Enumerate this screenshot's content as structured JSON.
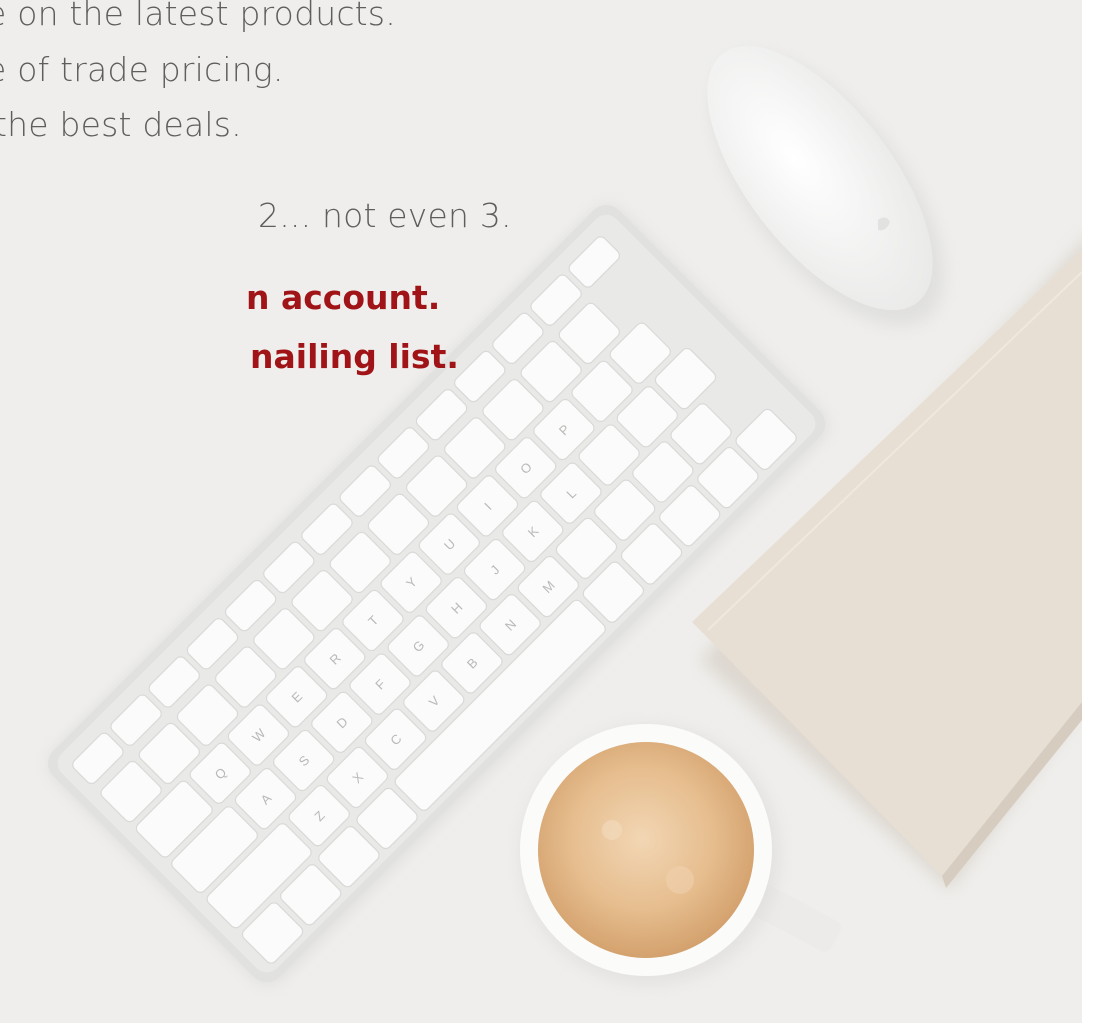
{
  "copy": {
    "line1": "e on the latest products.",
    "line2": "e of trade pricing.",
    "line3": "the best deals.",
    "line4": "2... not even 3.",
    "cta1": "n account.",
    "cta2": "nailing list."
  },
  "key_labels": [
    "Q",
    "W",
    "E",
    "R",
    "T",
    "Y",
    "U",
    "I",
    "O",
    "P",
    "A",
    "S",
    "D",
    "F",
    "G",
    "H",
    "J",
    "K",
    "L",
    "Z",
    "X",
    "C",
    "V",
    "B",
    "N",
    "M"
  ],
  "colors": {
    "background": "#efeeec",
    "body_text": "#5e5e5e",
    "accent_text": "#a01418",
    "notebook": "#e6ddd1",
    "coffee": "#e4b887"
  }
}
